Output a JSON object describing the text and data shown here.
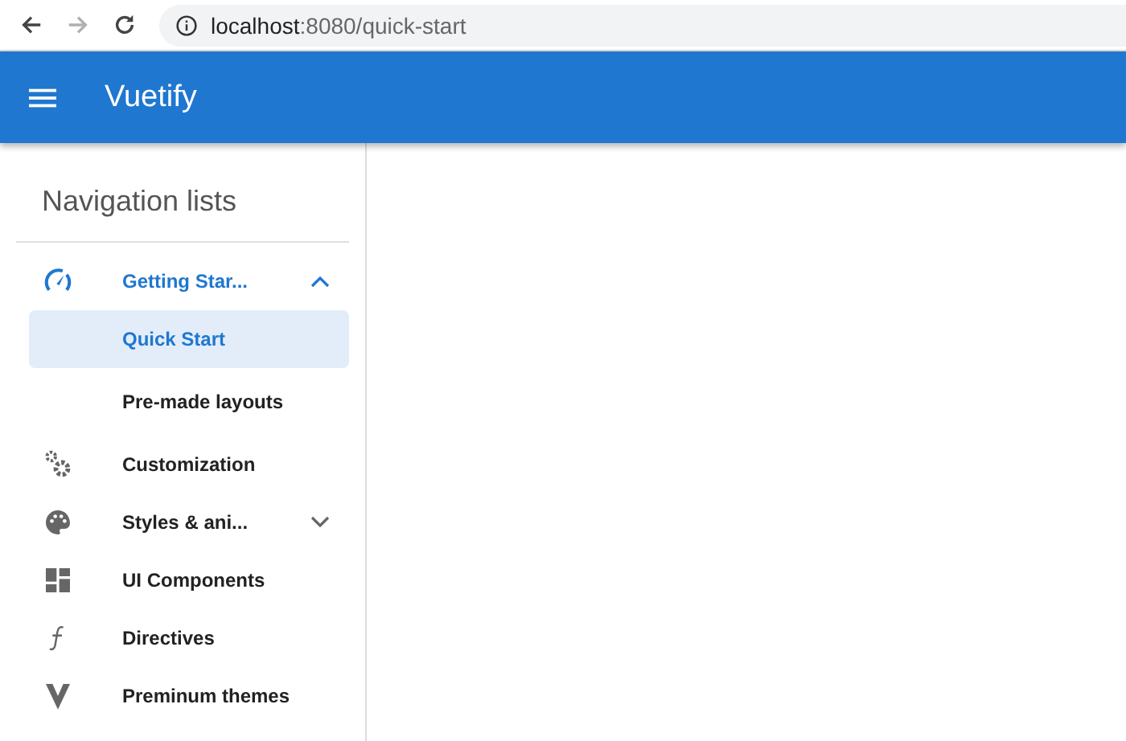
{
  "browser": {
    "back": {
      "disabled": false
    },
    "forward": {
      "disabled": true
    },
    "url_host": "localhost",
    "url_rest": ":8080/quick-start"
  },
  "app_bar": {
    "title": "Vuetify"
  },
  "sidebar": {
    "title": "Navigation lists",
    "items": [
      {
        "kind": "group",
        "label": "Getting Star...",
        "active": true,
        "expanded": true,
        "children": [
          {
            "label": "Quick Start",
            "selected": true
          },
          {
            "label": "Pre-made layouts",
            "selected": false
          }
        ]
      },
      {
        "kind": "link",
        "label": "Customization"
      },
      {
        "kind": "group",
        "label": "Styles & ani...",
        "active": false,
        "expanded": false
      },
      {
        "kind": "link",
        "label": "UI Components"
      },
      {
        "kind": "link",
        "label": "Directives"
      },
      {
        "kind": "link",
        "label": "Preminum themes"
      }
    ]
  }
}
